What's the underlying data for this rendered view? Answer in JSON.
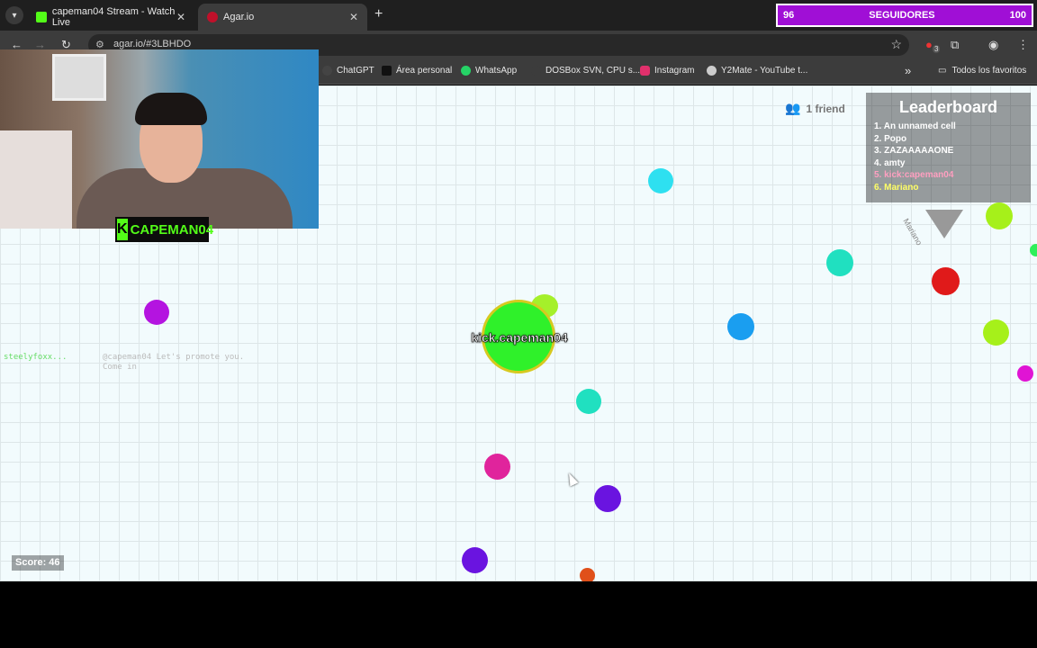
{
  "browser": {
    "tabs": [
      {
        "label": "capeman04 Stream - Watch Live",
        "favicon_color": "#53fc18"
      },
      {
        "label": "Agar.io",
        "favicon_color": "#c0102a"
      }
    ],
    "url": "agar.io/#3LBHDO",
    "bookmarks": [
      {
        "label": "ChatGPT",
        "icon_color": "#444444"
      },
      {
        "label": "Área personal",
        "icon_color": "#111111"
      },
      {
        "label": "WhatsApp",
        "icon_color": "#25d366"
      },
      {
        "label": "DOSBox SVN, CPU s...",
        "icon_color": "#3c3c3c"
      },
      {
        "label": "Instagram",
        "icon_color": "#e1306c"
      },
      {
        "label": "Y2Mate - YouTube t...",
        "icon_color": "#cccccc"
      }
    ],
    "bookmarks_more": "»",
    "all_favorites": "Todos los favoritos",
    "ext_badge": "3"
  },
  "followers": {
    "current": "96",
    "label": "SEGUIDORES",
    "goal": "100"
  },
  "stream": {
    "logo_letter": "K",
    "channel": "CAPEMAN04"
  },
  "game": {
    "player_name": "kick.capeman04",
    "score_text": "Score: 46",
    "friends_text": "1 friend",
    "leaderboard_title": "Leaderboard",
    "leaderboard": [
      {
        "text": "1. An unnamed cell",
        "color": "#ffffff"
      },
      {
        "text": "2. Popo",
        "color": "#ffffff"
      },
      {
        "text": "3. ZAZAAAAAONE",
        "color": "#ffffff"
      },
      {
        "text": "4. amty",
        "color": "#ffffff"
      },
      {
        "text": "5. kick:capeman04",
        "color": "#ff9fc0"
      },
      {
        "text": "6. Mariano",
        "color": "#ffff66"
      }
    ],
    "marker_name": "Mariano",
    "chat_sender": "steelyfoxx...",
    "chat_message": "@capeman04 Let's promote you. Come in",
    "pellet_colors": [
      "#2ee0f0",
      "#b414e0",
      "#20e0c0",
      "#1a9ef0",
      "#e0249c",
      "#6a14e0",
      "#e0501a",
      "#e01a1a",
      "#a6f01a",
      "#e014d4"
    ]
  }
}
